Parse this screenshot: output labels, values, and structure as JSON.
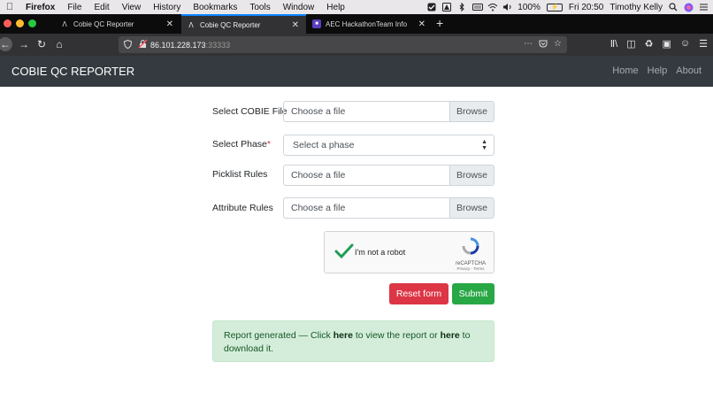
{
  "menubar": {
    "app": "Firefox",
    "menus": [
      "File",
      "Edit",
      "View",
      "History",
      "Bookmarks",
      "Tools",
      "Window",
      "Help"
    ],
    "battery": "100%",
    "clock": "Fri 20:50",
    "user": "Timothy Kelly"
  },
  "tabs": [
    {
      "label": "Cobie QC Reporter",
      "icon": "a-logo-icon",
      "active": false
    },
    {
      "label": "Cobie QC Reporter",
      "icon": "a-logo-icon",
      "active": true
    },
    {
      "label": "AEC HackathonTeam Info",
      "icon": "aec-icon",
      "active": false
    }
  ],
  "address": {
    "host": "86.101.228.173",
    "port": ":33333"
  },
  "app": {
    "brand": "COBIE QC REPORTER",
    "nav": [
      "Home",
      "Help",
      "About"
    ]
  },
  "form": {
    "cobie_label": "Select COBIE File",
    "phase_label": "Select Phase",
    "phase_required": "*",
    "picklist_label": "Picklist Rules",
    "attribute_label": "Attribute Rules",
    "file_placeholder": "Choose a file",
    "browse_label": "Browse",
    "phase_placeholder": "Select a phase",
    "captcha_text": "I'm not a robot",
    "captcha_brand": "reCAPTCHA",
    "captcha_links": "Privacy - Terms",
    "reset_label": "Reset form",
    "submit_label": "Submit"
  },
  "alert": {
    "part1": "Report generated — Click ",
    "link1": "here",
    "part2": " to view the report or ",
    "link2": "here",
    "part3": " to download it."
  },
  "colors": {
    "navbar": "#343a40",
    "danger": "#dc3545",
    "success": "#28a745",
    "alert_bg": "#d4edda"
  }
}
